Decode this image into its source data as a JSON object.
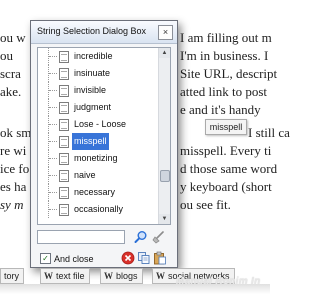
{
  "document": {
    "lines_left": [
      "ou w",
      "",
      "ou",
      "scra",
      "ake.",
      "",
      "",
      "",
      "ok sm",
      "re wi",
      "ice fo",
      "es ha",
      "sy m"
    ],
    "lines_right": [
      "I am filling out m",
      "I'm in business. I",
      "Site URL, descript",
      "atted link to post ",
      "e and it's handy",
      "",
      "",
      "I still ca",
      "misspell. Every ti",
      "d those same word",
      "y keyboard (short",
      "ou see fit."
    ]
  },
  "popup": {
    "word": "misspell"
  },
  "dialog": {
    "title": "String Selection Dialog Box",
    "close": "×",
    "items": [
      "incredible",
      "insinuate",
      "invisible",
      "judgment",
      "Lose - Loose",
      "misspell",
      "monetizing",
      "naive",
      "necessary",
      "occasionally"
    ],
    "selected_item": "misspell",
    "search": {
      "value": "",
      "placeholder": ""
    },
    "checkbox_label": "And close",
    "checkbox_checked": true
  },
  "tabs": [
    {
      "label": "tory",
      "has_w": false
    },
    {
      "label": "text file",
      "has_w": true
    },
    {
      "label": "blogs",
      "has_w": true
    },
    {
      "label": "social networks",
      "has_w": true
    }
  ],
  "watermark": "Manual Ronim In",
  "colors": {
    "selection": "#3874d8",
    "delete_red": "#d8302a",
    "search_blue": "#2a6fd6"
  }
}
